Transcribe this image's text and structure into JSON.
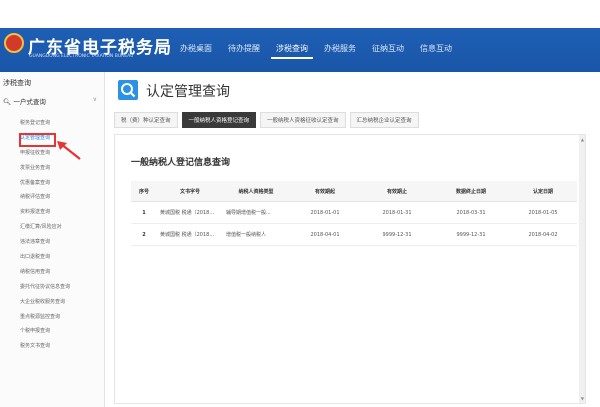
{
  "header": {
    "title": "广东省电子税务局",
    "subtitle": "GUANGDONG ELECTRONIC TAXATION BUREAU",
    "nav": [
      "办税桌面",
      "待办提醒",
      "涉税查询",
      "办税服务",
      "征纳互动",
      "信息互动"
    ],
    "nav_active_index": 2
  },
  "sidebar": {
    "title": "涉税查询",
    "group": "一户式查询",
    "items": [
      "税务登记查询",
      "认定管理查询",
      "申报征收查询",
      "发票业务查询",
      "优惠备案查询",
      "纳税评估查询",
      "资料报送查询",
      "汇缴汇算/风险应对",
      "违法违章查询",
      "出口退税查询",
      "纳税信用查询",
      "委托代征协议信息查询",
      "大企业税收服务查询",
      "重点税源监控查询",
      "个税申报查询",
      "税务文书查询"
    ],
    "active_index": 1
  },
  "page": {
    "title": "认定管理查询",
    "tabs": [
      "税（费）种认定查询",
      "一般纳税人资格登记查询",
      "一般纳税人资格征收认定查询",
      "汇总纳税企业认定查询"
    ],
    "active_tab": 1
  },
  "table": {
    "section_title": "一般纳税人登记信息查询",
    "columns": [
      "序号",
      "文书字号",
      "纳税人资格类型",
      "有效期起",
      "有效期止",
      "数据终止日期",
      "认定日期"
    ],
    "rows": [
      [
        "1",
        "黄城国税 税通〔2018...",
        "辅导期增值税一般...",
        "2018-01-01",
        "2018-01-31",
        "2018-03-31",
        "2018-01-05"
      ],
      [
        "2",
        "黄城国税 税通〔2018...",
        "增值税一般纳税人",
        "2018-04-01",
        "9999-12-31",
        "9999-12-31",
        "2018-04-02"
      ]
    ]
  },
  "colors": {
    "header_blue": "#1e5fb4",
    "accent_blue": "#2b93e6",
    "highlight_red": "#e63333",
    "tab_active": "#3a3a3a"
  }
}
